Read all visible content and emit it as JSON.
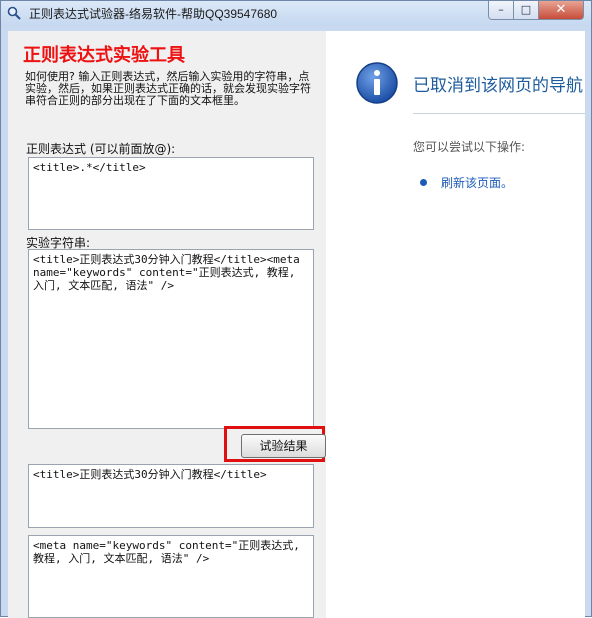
{
  "window": {
    "title": "正则表达式试验器-络易软件-帮助QQ39547680",
    "min_symbol": "–",
    "max_symbol": "□",
    "close_symbol": "✕"
  },
  "app": {
    "heading": "正则表达式实验工具",
    "help_text": "如何使用? 输入正则表达式，然后输入实验用的字符串，点实验，然后，如果正则表达式正确的话，就会发现实验字符串符合正则的部分出现在了下面的文本框里。",
    "regex_label": "正则表达式 (可以前面放@):",
    "regex_value": "<title>.*</title>",
    "test_label": "实验字符串:",
    "test_value": "<title>正则表达式30分钟入门教程</title><meta name=\"keywords\" content=\"正则表达式, 教程, 入门, 文本匹配, 语法\" />",
    "run_button": "试验结果",
    "result1": "<title>正则表达式30分钟入门教程</title>",
    "result2": "<meta name=\"keywords\" content=\"正则表达式, 教程, 入门, 文本匹配, 语法\" />"
  },
  "browser": {
    "heading": "已取消到该网页的导航",
    "subheading": "您可以尝试以下操作:",
    "refresh_link": "刷新该页面。"
  },
  "colors": {
    "heading_red": "#ee1111",
    "highlight_red": "#e01010",
    "link_blue": "#1d5bb8",
    "nav_heading_blue": "#1d5b9c"
  }
}
